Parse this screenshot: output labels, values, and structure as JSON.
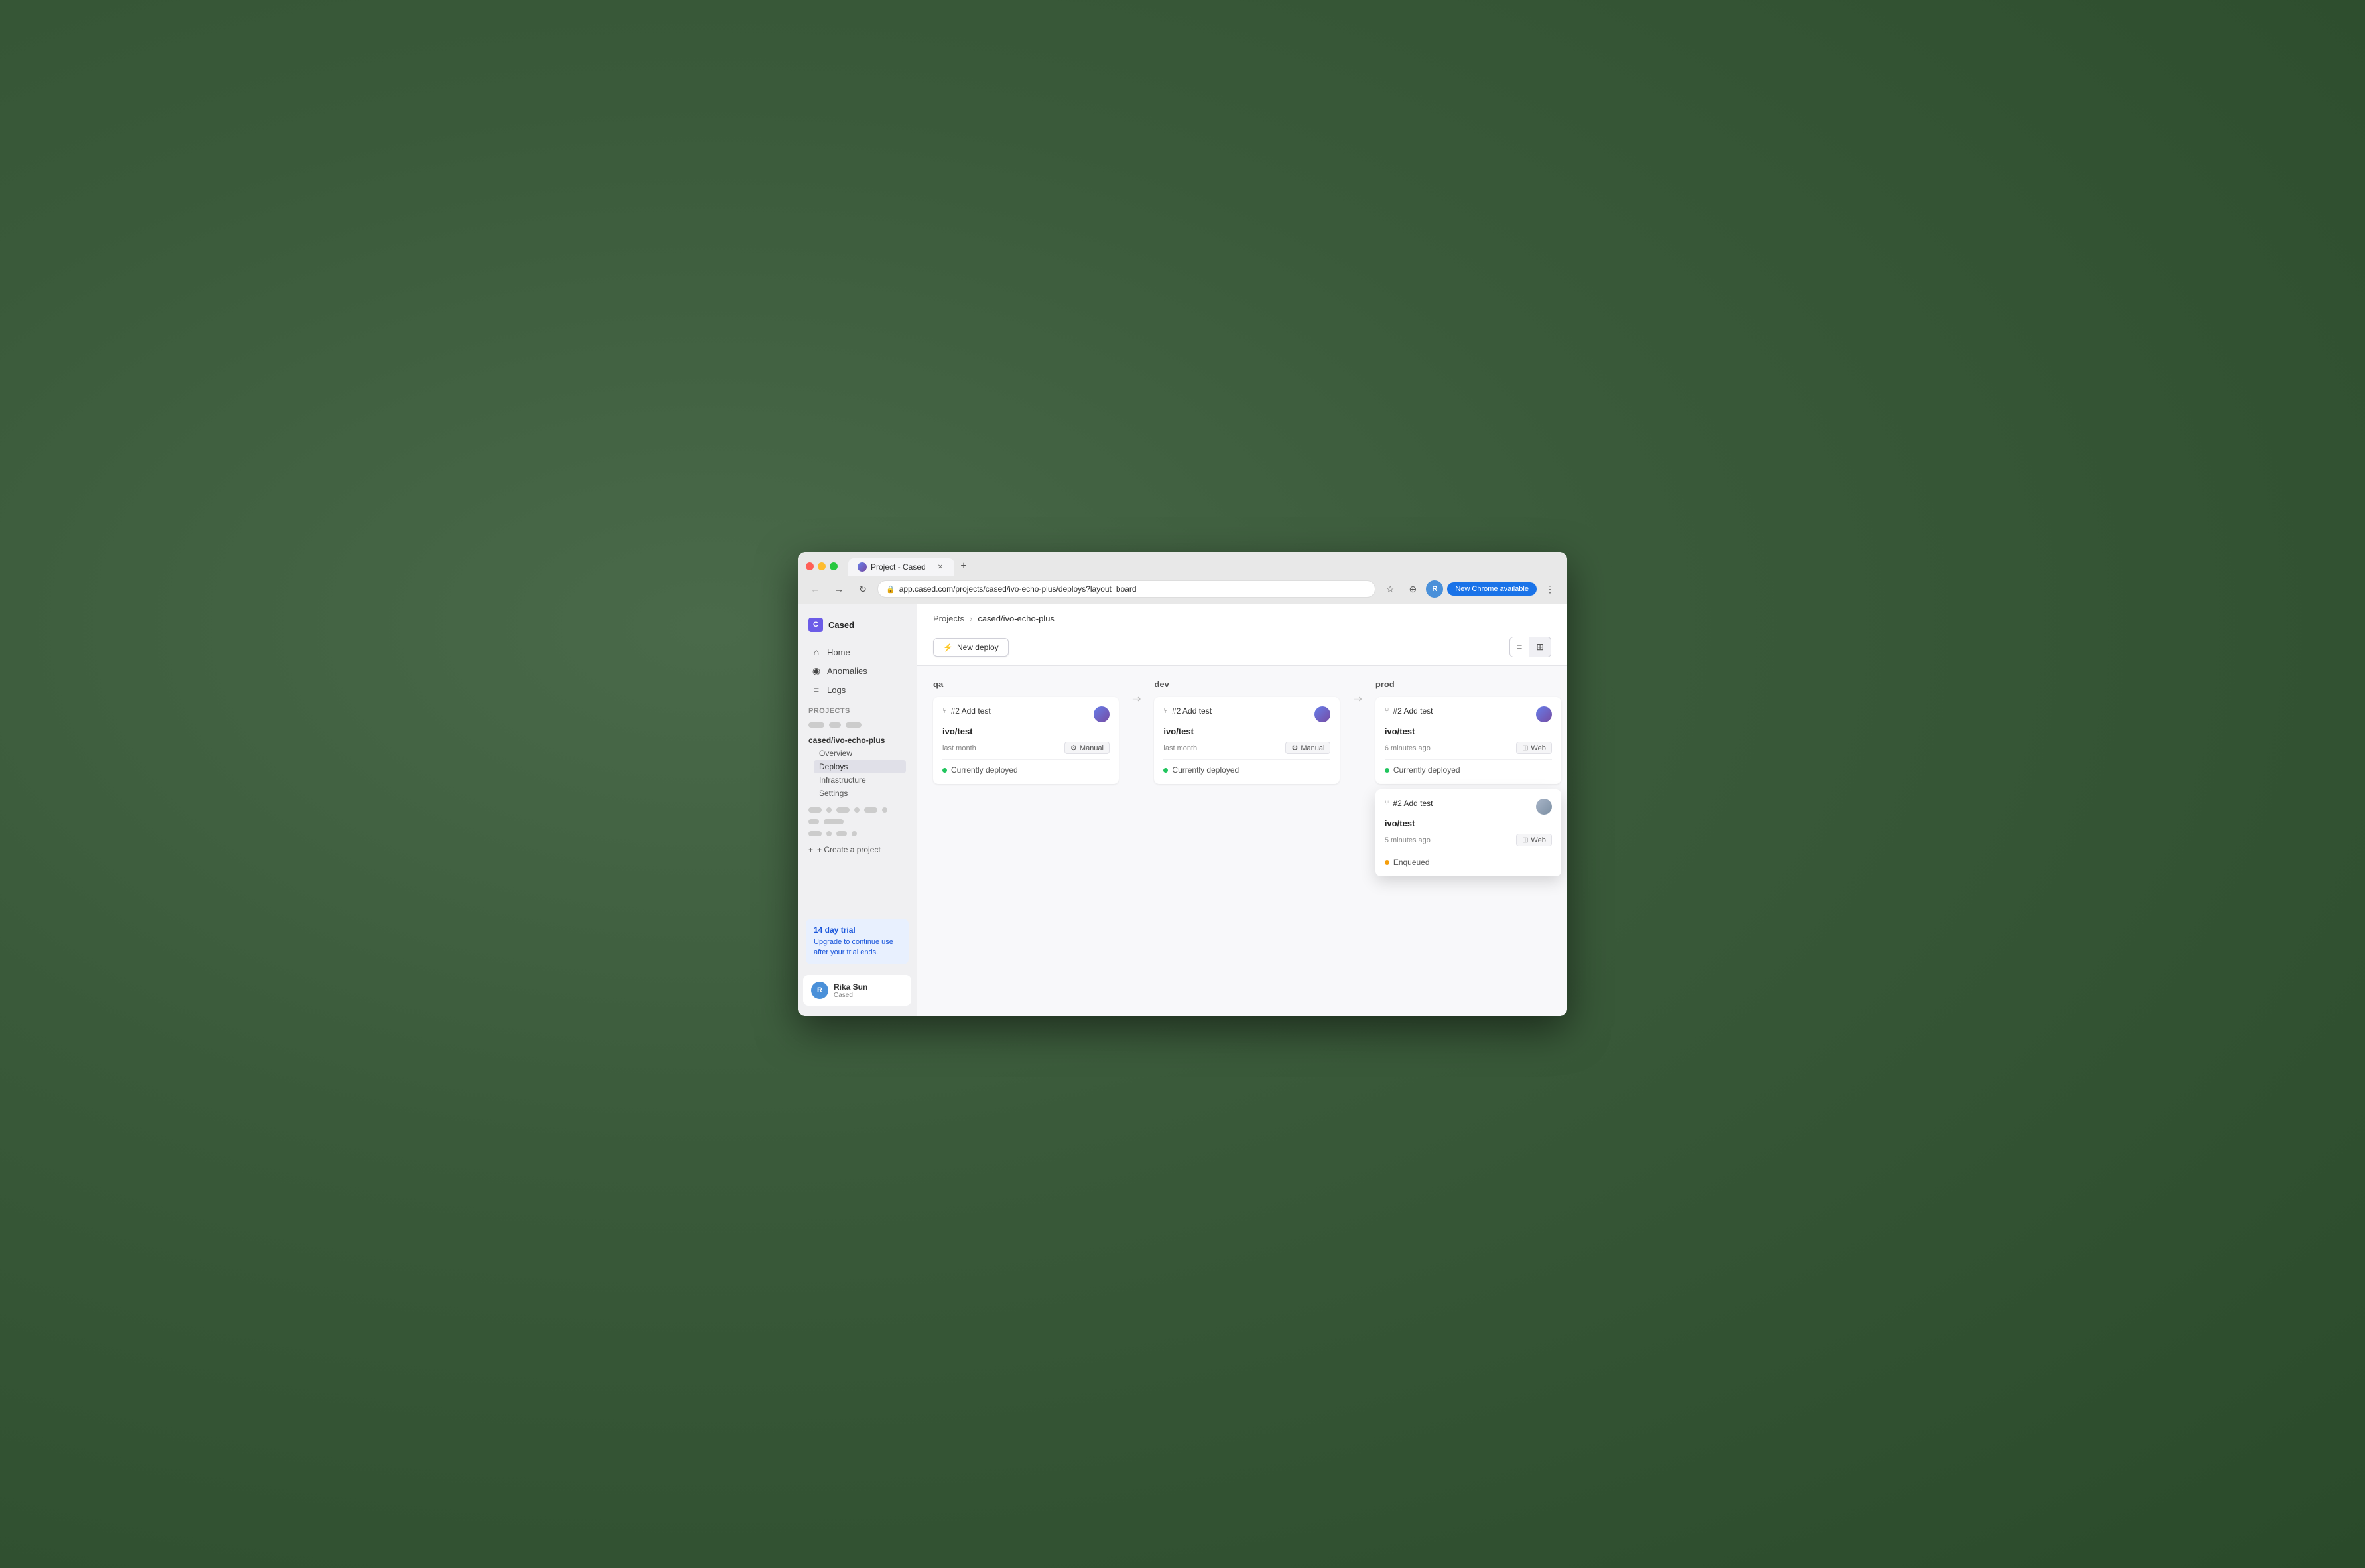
{
  "browser": {
    "tab_title": "Project - Cased",
    "tab_new_label": "+",
    "address": "app.cased.com/projects/cased/ivo-echo-plus/deploys?layout=board",
    "chrome_update": "New Chrome available",
    "user_initial": "R",
    "back_icon": "←",
    "forward_icon": "→",
    "refresh_icon": "↻",
    "dropdown_icon": "⌄"
  },
  "sidebar": {
    "org_initial": "C",
    "org_name": "Cased",
    "nav_items": [
      {
        "label": "Home",
        "icon": "⌂"
      },
      {
        "label": "Anomalies",
        "icon": "◉"
      },
      {
        "label": "Logs",
        "icon": "≡"
      }
    ],
    "section_label": "Projects",
    "current_project": "cased/ivo-echo-plus",
    "sub_items": [
      {
        "label": "Overview",
        "active": false
      },
      {
        "label": "Deploys",
        "active": true
      },
      {
        "label": "Infrastructure",
        "active": false
      },
      {
        "label": "Settings",
        "active": false
      }
    ],
    "create_project_label": "+ Create a project",
    "trial": {
      "title": "14 day trial",
      "description": "Upgrade to continue use after your trial ends."
    },
    "user": {
      "initial": "R",
      "name": "Rika Sun",
      "org": "Cased"
    }
  },
  "main": {
    "breadcrumb_projects": "Projects",
    "breadcrumb_sep": "›",
    "breadcrumb_current": "cased/ivo-echo-plus",
    "new_deploy_label": "New deploy",
    "view_list_icon": "≡",
    "view_grid_icon": "⊞",
    "columns": [
      {
        "id": "qa",
        "label": "qa",
        "cards": [
          {
            "id": "qa-1",
            "title": "#2 Add test",
            "branch": "ivo/test",
            "time": "last month",
            "badge": "Manual",
            "badge_icon": "⚙",
            "status": "Currently deployed",
            "status_type": "green"
          }
        ]
      },
      {
        "id": "dev",
        "label": "dev",
        "cards": [
          {
            "id": "dev-1",
            "title": "#2 Add test",
            "branch": "ivo/test",
            "time": "last month",
            "badge": "Manual",
            "badge_icon": "⚙",
            "status": "Currently deployed",
            "status_type": "green"
          }
        ]
      },
      {
        "id": "prod",
        "label": "prod",
        "cards": [
          {
            "id": "prod-1",
            "title": "#2 Add test",
            "branch": "ivo/test",
            "time": "6 minutes ago",
            "badge": "Web",
            "badge_icon": "⊞",
            "status": "Currently deployed",
            "status_type": "green"
          },
          {
            "id": "prod-2",
            "title": "#2 Add test",
            "branch": "ivo/test",
            "time": "5 minutes ago",
            "badge": "Web",
            "badge_icon": "⊞",
            "status": "Enqueued",
            "status_type": "orange",
            "elevated": true
          }
        ]
      }
    ]
  }
}
